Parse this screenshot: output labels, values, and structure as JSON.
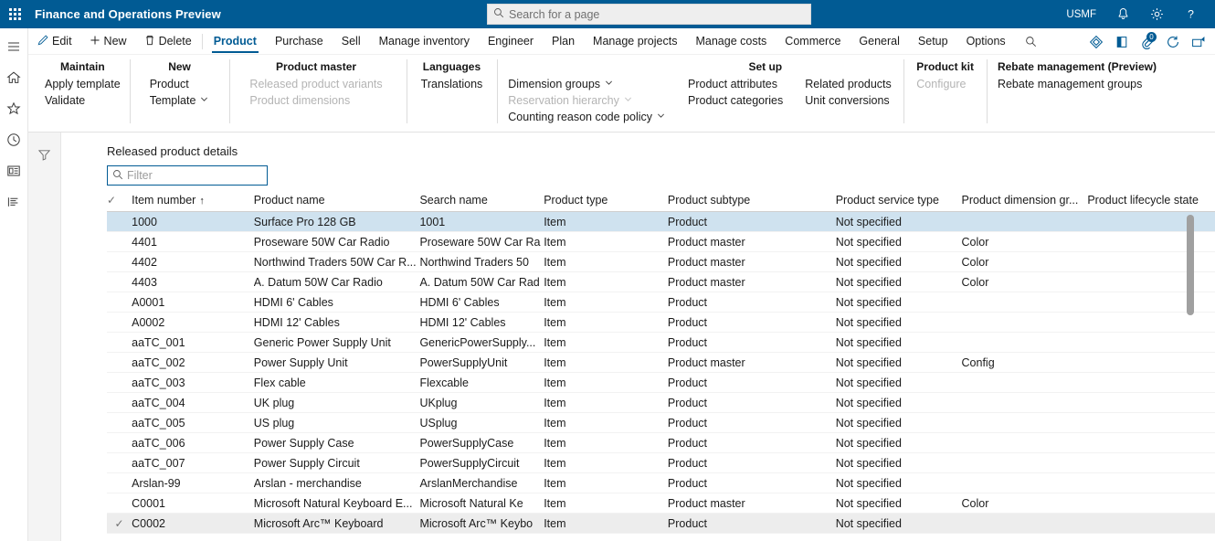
{
  "topbar": {
    "app_title": "Finance and Operations Preview",
    "waffle_icon": "app-launcher-icon",
    "search": {
      "placeholder": "Search for a page",
      "icon": "search-icon"
    },
    "right_items": [
      {
        "name": "company-selector",
        "label": "USMF",
        "icon": ""
      },
      {
        "name": "notifications-button",
        "label": "",
        "icon": "bell-icon"
      },
      {
        "name": "settings-button",
        "label": "",
        "icon": "gear-icon"
      },
      {
        "name": "help-button",
        "label": "",
        "icon": "question-mark-icon"
      }
    ]
  },
  "rail": {
    "items": [
      {
        "name": "navigation-menu-button",
        "icon": "hamburger-icon"
      },
      {
        "name": "home-button",
        "icon": "home-icon"
      },
      {
        "name": "favorites-button",
        "icon": "star-icon"
      },
      {
        "name": "recent-button",
        "icon": "clock-icon"
      },
      {
        "name": "workspaces-button",
        "icon": "workspace-icon"
      },
      {
        "name": "modules-button",
        "icon": "modules-list-icon"
      }
    ]
  },
  "commandbar": {
    "buttons": [
      {
        "name": "edit-button",
        "label": "Edit",
        "icon": "pencil-icon"
      },
      {
        "name": "new-button",
        "label": "New",
        "icon": "plus-icon"
      },
      {
        "name": "delete-button",
        "label": "Delete",
        "icon": "trash-icon"
      }
    ],
    "tabs": [
      {
        "name": "tab-product",
        "label": "Product",
        "active": true
      },
      {
        "name": "tab-purchase",
        "label": "Purchase",
        "active": false
      },
      {
        "name": "tab-sell",
        "label": "Sell",
        "active": false
      },
      {
        "name": "tab-manage-inventory",
        "label": "Manage inventory",
        "active": false
      },
      {
        "name": "tab-engineer",
        "label": "Engineer",
        "active": false
      },
      {
        "name": "tab-plan",
        "label": "Plan",
        "active": false
      },
      {
        "name": "tab-manage-projects",
        "label": "Manage projects",
        "active": false
      },
      {
        "name": "tab-manage-costs",
        "label": "Manage costs",
        "active": false
      },
      {
        "name": "tab-commerce",
        "label": "Commerce",
        "active": false
      },
      {
        "name": "tab-general",
        "label": "General",
        "active": false
      },
      {
        "name": "tab-setup",
        "label": "Setup",
        "active": false
      },
      {
        "name": "tab-options",
        "label": "Options",
        "active": false
      }
    ],
    "search_icon": "search-icon",
    "right_icons": [
      {
        "name": "personalize-icon",
        "badge": ""
      },
      {
        "name": "open-in-new-window-icon",
        "badge": ""
      },
      {
        "name": "attachments-icon",
        "badge": "0"
      },
      {
        "name": "refresh-icon",
        "badge": ""
      },
      {
        "name": "share-icon",
        "badge": ""
      }
    ]
  },
  "ribbon": {
    "groups": [
      {
        "name": "ribbon-group-maintain",
        "header": "Maintain",
        "columns": [
          [
            {
              "name": "apply-template-item",
              "label": "Apply template",
              "disabled": false,
              "chevron": false
            },
            {
              "name": "validate-item",
              "label": "Validate",
              "disabled": false,
              "chevron": false
            }
          ]
        ]
      },
      {
        "name": "ribbon-group-new",
        "header": "New",
        "columns": [
          [
            {
              "name": "product-item",
              "label": "Product",
              "disabled": false,
              "chevron": false
            },
            {
              "name": "template-item",
              "label": "Template",
              "disabled": false,
              "chevron": true
            }
          ]
        ]
      },
      {
        "name": "ribbon-group-product-master",
        "header": "Product master",
        "columns": [
          [
            {
              "name": "released-product-variants-item",
              "label": "Released product variants",
              "disabled": true,
              "chevron": false
            },
            {
              "name": "product-dimensions-item",
              "label": "Product dimensions",
              "disabled": true,
              "chevron": false
            }
          ]
        ]
      },
      {
        "name": "ribbon-group-languages",
        "header": "Languages",
        "columns": [
          [
            {
              "name": "translations-item",
              "label": "Translations",
              "disabled": false,
              "chevron": false
            }
          ]
        ]
      },
      {
        "name": "ribbon-group-setup",
        "header": "Set up",
        "columns": [
          [
            {
              "name": "dimension-groups-item",
              "label": "Dimension groups",
              "disabled": false,
              "chevron": true
            },
            {
              "name": "reservation-hierarchy-item",
              "label": "Reservation hierarchy",
              "disabled": true,
              "chevron": true
            },
            {
              "name": "counting-reason-code-policy-item",
              "label": "Counting reason code policy",
              "disabled": false,
              "chevron": true
            }
          ],
          [
            {
              "name": "product-attributes-item",
              "label": "Product attributes",
              "disabled": false,
              "chevron": false
            },
            {
              "name": "product-categories-item",
              "label": "Product categories",
              "disabled": false,
              "chevron": false
            }
          ],
          [
            {
              "name": "related-products-item",
              "label": "Related products",
              "disabled": false,
              "chevron": false
            },
            {
              "name": "unit-conversions-item",
              "label": "Unit conversions",
              "disabled": false,
              "chevron": false
            }
          ]
        ]
      },
      {
        "name": "ribbon-group-product-kit",
        "header": "Product kit",
        "columns": [
          [
            {
              "name": "configure-item",
              "label": "Configure",
              "disabled": true,
              "chevron": false
            }
          ]
        ]
      },
      {
        "name": "ribbon-group-rebate-management",
        "header": "Rebate management (Preview)",
        "columns": [
          [
            {
              "name": "rebate-management-groups-item",
              "label": "Rebate management groups",
              "disabled": false,
              "chevron": false
            }
          ]
        ]
      }
    ]
  },
  "grid": {
    "filter_pane_icon": "funnel-icon",
    "title": "Released product details",
    "filter": {
      "placeholder": "Filter",
      "value": "",
      "icon": "search-icon"
    },
    "sort_indicator": "↑",
    "columns": [
      {
        "name": "col-item-number",
        "label": "Item number",
        "sorted": true
      },
      {
        "name": "col-product-name",
        "label": "Product name",
        "sorted": false
      },
      {
        "name": "col-search-name",
        "label": "Search name",
        "sorted": false
      },
      {
        "name": "col-product-type",
        "label": "Product type",
        "sorted": false
      },
      {
        "name": "col-product-subtype",
        "label": "Product subtype",
        "sorted": false
      },
      {
        "name": "col-product-service-type",
        "label": "Product service type",
        "sorted": false
      },
      {
        "name": "col-product-dimension-group",
        "label": "Product dimension gr...",
        "sorted": false
      },
      {
        "name": "col-product-lifecycle-state",
        "label": "Product lifecycle state",
        "sorted": false
      }
    ],
    "rows": [
      {
        "checked": false,
        "selected": true,
        "hover": false,
        "item_number": "1000",
        "product_name": "Surface Pro 128 GB",
        "search_name": "1001",
        "product_type": "Item",
        "product_subtype": "Product",
        "product_service_type": "Not specified",
        "product_dimension_group": "",
        "product_lifecycle_state": ""
      },
      {
        "checked": false,
        "selected": false,
        "hover": false,
        "item_number": "4401",
        "product_name": "Proseware 50W Car Radio",
        "search_name": "Proseware 50W Car Ra",
        "product_type": "Item",
        "product_subtype": "Product master",
        "product_service_type": "Not specified",
        "product_dimension_group": "Color",
        "product_lifecycle_state": ""
      },
      {
        "checked": false,
        "selected": false,
        "hover": false,
        "item_number": "4402",
        "product_name": "Northwind Traders 50W Car R...",
        "search_name": "Northwind Traders 50",
        "product_type": "Item",
        "product_subtype": "Product master",
        "product_service_type": "Not specified",
        "product_dimension_group": "Color",
        "product_lifecycle_state": ""
      },
      {
        "checked": false,
        "selected": false,
        "hover": false,
        "item_number": "4403",
        "product_name": "A. Datum 50W Car Radio",
        "search_name": "A. Datum 50W Car Rad",
        "product_type": "Item",
        "product_subtype": "Product master",
        "product_service_type": "Not specified",
        "product_dimension_group": "Color",
        "product_lifecycle_state": ""
      },
      {
        "checked": false,
        "selected": false,
        "hover": false,
        "item_number": "A0001",
        "product_name": "HDMI 6' Cables",
        "search_name": "HDMI 6' Cables",
        "product_type": "Item",
        "product_subtype": "Product",
        "product_service_type": "Not specified",
        "product_dimension_group": "",
        "product_lifecycle_state": ""
      },
      {
        "checked": false,
        "selected": false,
        "hover": false,
        "item_number": "A0002",
        "product_name": "HDMI 12' Cables",
        "search_name": "HDMI 12' Cables",
        "product_type": "Item",
        "product_subtype": "Product",
        "product_service_type": "Not specified",
        "product_dimension_group": "",
        "product_lifecycle_state": ""
      },
      {
        "checked": false,
        "selected": false,
        "hover": false,
        "item_number": "aaTC_001",
        "product_name": "Generic Power Supply Unit",
        "search_name": "GenericPowerSupply...",
        "product_type": "Item",
        "product_subtype": "Product",
        "product_service_type": "Not specified",
        "product_dimension_group": "",
        "product_lifecycle_state": ""
      },
      {
        "checked": false,
        "selected": false,
        "hover": false,
        "item_number": "aaTC_002",
        "product_name": "Power Supply Unit",
        "search_name": "PowerSupplyUnit",
        "product_type": "Item",
        "product_subtype": "Product master",
        "product_service_type": "Not specified",
        "product_dimension_group": "Config",
        "product_lifecycle_state": ""
      },
      {
        "checked": false,
        "selected": false,
        "hover": false,
        "item_number": "aaTC_003",
        "product_name": "Flex cable",
        "search_name": "Flexcable",
        "product_type": "Item",
        "product_subtype": "Product",
        "product_service_type": "Not specified",
        "product_dimension_group": "",
        "product_lifecycle_state": ""
      },
      {
        "checked": false,
        "selected": false,
        "hover": false,
        "item_number": "aaTC_004",
        "product_name": "UK plug",
        "search_name": "UKplug",
        "product_type": "Item",
        "product_subtype": "Product",
        "product_service_type": "Not specified",
        "product_dimension_group": "",
        "product_lifecycle_state": ""
      },
      {
        "checked": false,
        "selected": false,
        "hover": false,
        "item_number": "aaTC_005",
        "product_name": "US plug",
        "search_name": "USplug",
        "product_type": "Item",
        "product_subtype": "Product",
        "product_service_type": "Not specified",
        "product_dimension_group": "",
        "product_lifecycle_state": ""
      },
      {
        "checked": false,
        "selected": false,
        "hover": false,
        "item_number": "aaTC_006",
        "product_name": "Power Supply Case",
        "search_name": "PowerSupplyCase",
        "product_type": "Item",
        "product_subtype": "Product",
        "product_service_type": "Not specified",
        "product_dimension_group": "",
        "product_lifecycle_state": ""
      },
      {
        "checked": false,
        "selected": false,
        "hover": false,
        "item_number": "aaTC_007",
        "product_name": "Power Supply Circuit",
        "search_name": "PowerSupplyCircuit",
        "product_type": "Item",
        "product_subtype": "Product",
        "product_service_type": "Not specified",
        "product_dimension_group": "",
        "product_lifecycle_state": ""
      },
      {
        "checked": false,
        "selected": false,
        "hover": false,
        "item_number": "Arslan-99",
        "product_name": "Arslan - merchandise",
        "search_name": "ArslanMerchandise",
        "product_type": "Item",
        "product_subtype": "Product",
        "product_service_type": "Not specified",
        "product_dimension_group": "",
        "product_lifecycle_state": ""
      },
      {
        "checked": false,
        "selected": false,
        "hover": false,
        "item_number": "C0001",
        "product_name": "Microsoft Natural Keyboard E...",
        "search_name": "Microsoft Natural Ke",
        "product_type": "Item",
        "product_subtype": "Product master",
        "product_service_type": "Not specified",
        "product_dimension_group": "Color",
        "product_lifecycle_state": ""
      },
      {
        "checked": true,
        "selected": false,
        "hover": true,
        "item_number": "C0002",
        "product_name": "Microsoft Arc™ Keyboard",
        "search_name": "Microsoft Arc™ Keybo",
        "product_type": "Item",
        "product_subtype": "Product",
        "product_service_type": "Not specified",
        "product_dimension_group": "",
        "product_lifecycle_state": ""
      }
    ]
  },
  "colors": {
    "brand_blue": "#015b94",
    "link_blue": "#015b94",
    "selected_row": "#cfe2ef",
    "hover_row": "#ededed"
  }
}
